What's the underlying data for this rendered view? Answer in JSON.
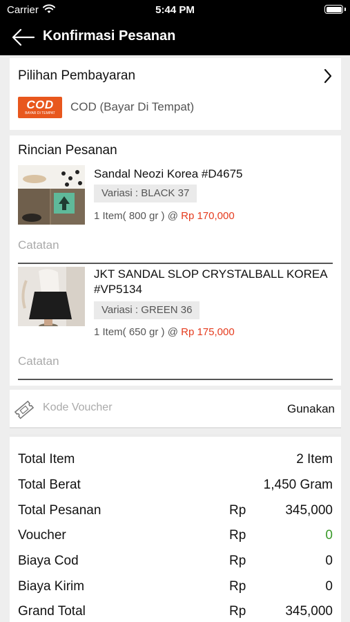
{
  "status_bar": {
    "carrier": "Carrier",
    "time": "5:44 PM"
  },
  "nav": {
    "title": "Konfirmasi Pesanan"
  },
  "payment": {
    "label": "Pilihan Pembayaran",
    "logo_text": "COD",
    "logo_subtext": "BAYAR DI TEMPAT",
    "method": "COD (Bayar Di Tempat)"
  },
  "order": {
    "heading": "Rincian Pesanan",
    "items": [
      {
        "name": "Sandal Neozi Korea #D4675",
        "variant": "Variasi : BLACK 37",
        "qty_weight": "1 Item( 800 gr ) @",
        "price": "Rp 170,000",
        "note_placeholder": "Catatan"
      },
      {
        "name": "JKT SANDAL SLOP CRYSTALBALL KOREA #VP5134",
        "variant": "Variasi : GREEN 36",
        "qty_weight": "1 Item( 650 gr ) @",
        "price": "Rp 175,000",
        "note_placeholder": "Catatan"
      }
    ]
  },
  "voucher": {
    "placeholder": "Kode Voucher",
    "apply_label": "Gunakan"
  },
  "summary": {
    "rows": [
      {
        "label": "Total Item",
        "currency": "",
        "value": "2 Item"
      },
      {
        "label": "Total Berat",
        "currency": "",
        "value": "1,450 Gram"
      },
      {
        "label": "Total Pesanan",
        "currency": "Rp",
        "value": "345,000"
      },
      {
        "label": "Voucher",
        "currency": "Rp",
        "value": "0"
      },
      {
        "label": "Biaya Cod",
        "currency": "Rp",
        "value": "0"
      },
      {
        "label": "Biaya Kirim",
        "currency": "Rp",
        "value": "0"
      },
      {
        "label": "Grand Total",
        "currency": "Rp",
        "value": "345,000"
      }
    ]
  },
  "colors": {
    "price": "#e53b1e",
    "cod_brand": "#e8571d",
    "voucher_value": "#3a9a2a"
  }
}
